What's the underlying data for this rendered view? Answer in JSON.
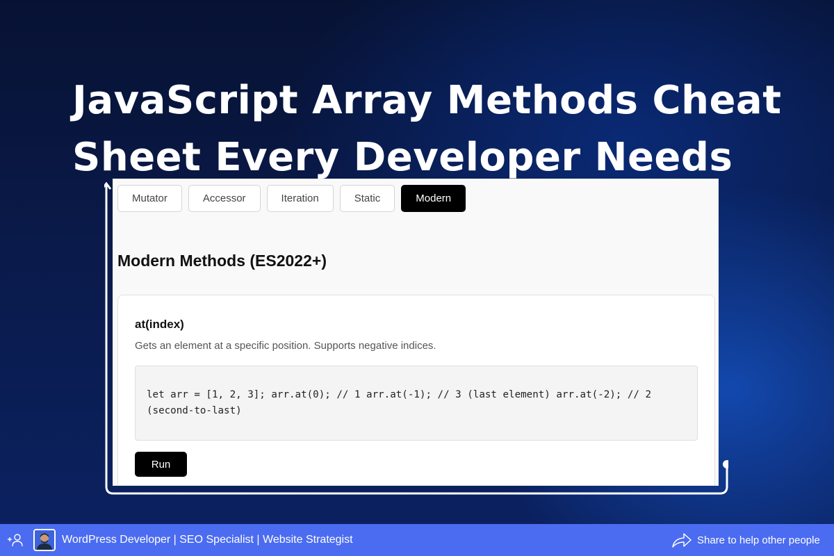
{
  "headline": {
    "line1": "JavaScript Array Methods Cheat",
    "line2": "Sheet Every Developer Needs"
  },
  "tabs": [
    {
      "label": "Mutator",
      "active": false
    },
    {
      "label": "Accessor",
      "active": false
    },
    {
      "label": "Iteration",
      "active": false
    },
    {
      "label": "Static",
      "active": false
    },
    {
      "label": "Modern",
      "active": true
    }
  ],
  "section_title": "Modern Methods (ES2022+)",
  "method": {
    "name": "at(index)",
    "description": "Gets an element at a specific position. Supports negative indices.",
    "code_line1": "let arr = [1, 2, 3]; arr.at(0); // 1 arr.at(-1); // 3 (last element) arr.at(-2); // 2",
    "code_line2": "(second-to-last)",
    "run_label": "Run"
  },
  "footer": {
    "author_text": "WordPress Developer | SEO Specialist | Website Strategist",
    "share_text": "Share to help other people"
  },
  "icons": {
    "follow": "add-user-icon",
    "share": "share-arrow-icon"
  },
  "colors": {
    "footer_bg": "#4b6cf0",
    "active_tab": "#000000",
    "run_button": "#000000"
  }
}
